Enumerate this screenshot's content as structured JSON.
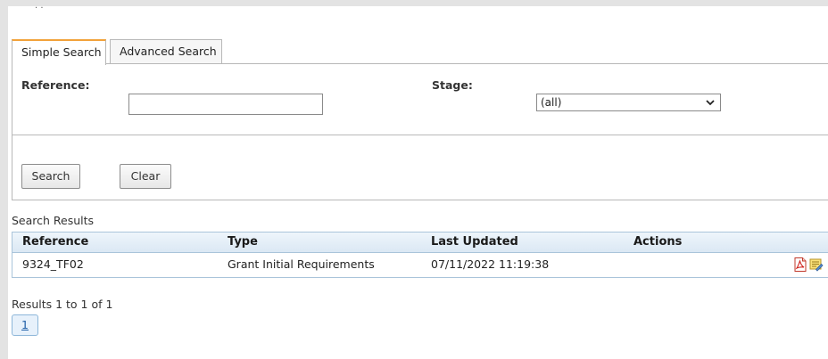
{
  "tabs": [
    {
      "label": "Simple Search",
      "active": true
    },
    {
      "label": "Advanced Search",
      "active": false
    }
  ],
  "search_form": {
    "reference_label": "Reference:",
    "reference_value": "",
    "stage_label": "Stage:",
    "stage_selected": "(all)"
  },
  "buttons": {
    "search_label": "Search",
    "clear_label": "Clear"
  },
  "results": {
    "title": "Search Results",
    "columns": [
      "Reference",
      "Type",
      "Last Updated",
      "Actions"
    ],
    "rows": [
      {
        "reference": "9324_TF02",
        "type": "Grant Initial Requirements",
        "last_updated": "07/11/2022 11:19:38",
        "actions": [
          "pdf-icon",
          "note-icon"
        ]
      }
    ],
    "summary": "Results 1 to 1 of 1",
    "pages": [
      "1"
    ]
  },
  "colors": {
    "tab_accent": "#f2a23a",
    "table_header_bg": "#dbe8f4",
    "table_border": "#aac4da",
    "page_link": "#1f5fa8"
  }
}
